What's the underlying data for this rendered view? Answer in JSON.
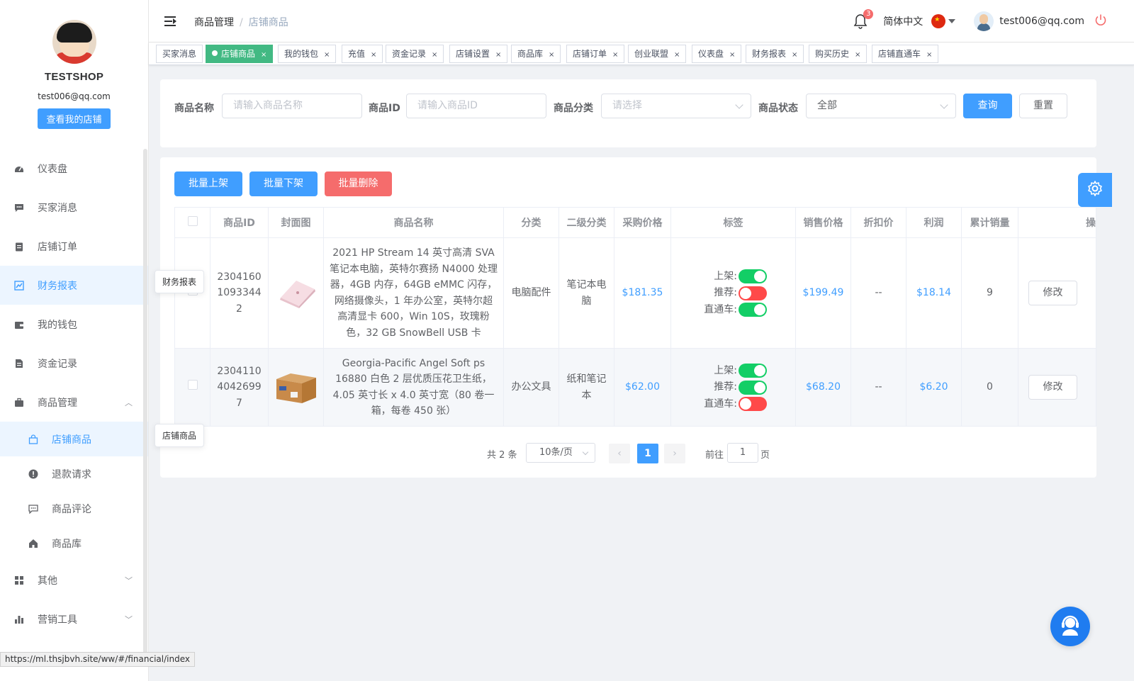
{
  "sidebar": {
    "shop_name": "TESTSHOP",
    "email": "test006@qq.com",
    "view_shop_btn": "查看我的店铺",
    "menu": [
      {
        "label": "仪表盘",
        "icon": "dashboard-icon"
      },
      {
        "label": "买家消息",
        "icon": "chat-icon"
      },
      {
        "label": "店铺订单",
        "icon": "clipboard-icon"
      },
      {
        "label": "财务报表",
        "icon": "chart-line-icon"
      },
      {
        "label": "我的钱包",
        "icon": "wallet-icon"
      },
      {
        "label": "资金记录",
        "icon": "document-icon"
      },
      {
        "label": "商品管理",
        "icon": "briefcase-icon"
      },
      {
        "label": "其他",
        "icon": "grid-icon"
      },
      {
        "label": "营销工具",
        "icon": "bar-chart-icon"
      }
    ],
    "submenu": [
      {
        "label": "店铺商品",
        "icon": "shopping-bag-icon"
      },
      {
        "label": "退款请求",
        "icon": "alert-circle-icon"
      },
      {
        "label": "商品评论",
        "icon": "comment-icon"
      },
      {
        "label": "商品库",
        "icon": "home-icon"
      }
    ],
    "tooltip_financial": "财务报表",
    "tooltip_store": "店铺商品"
  },
  "header": {
    "breadcrumb": [
      "商品管理",
      "店铺商品"
    ],
    "breadcrumb_sep": "/",
    "notification_count": "3",
    "language": "简体中文",
    "user": "test006@qq.com"
  },
  "tags": [
    {
      "label": "买家消息",
      "closable": false,
      "active": false
    },
    {
      "label": "店铺商品",
      "closable": true,
      "active": true
    },
    {
      "label": "我的钱包",
      "closable": true,
      "active": false
    },
    {
      "label": "充值",
      "closable": true,
      "active": false
    },
    {
      "label": "资金记录",
      "closable": true,
      "active": false
    },
    {
      "label": "店铺设置",
      "closable": true,
      "active": false
    },
    {
      "label": "商品库",
      "closable": true,
      "active": false
    },
    {
      "label": "店铺订单",
      "closable": true,
      "active": false
    },
    {
      "label": "创业联盟",
      "closable": true,
      "active": false
    },
    {
      "label": "仪表盘",
      "closable": true,
      "active": false
    },
    {
      "label": "财务报表",
      "closable": true,
      "active": false
    },
    {
      "label": "购买历史",
      "closable": true,
      "active": false
    },
    {
      "label": "店铺直通车",
      "closable": true,
      "active": false
    }
  ],
  "filter": {
    "name_label": "商品名称",
    "name_placeholder": "请输入商品名称",
    "id_label": "商品ID",
    "id_placeholder": "请输入商品ID",
    "category_label": "商品分类",
    "category_placeholder": "请选择",
    "status_label": "商品状态",
    "status_value": "全部",
    "search_btn": "查询",
    "reset_btn": "重置"
  },
  "actions": {
    "batch_on": "批量上架",
    "batch_off": "批量下架",
    "batch_delete": "批量删除"
  },
  "table": {
    "headers": [
      "商品ID",
      "封面图",
      "商品名称",
      "分类",
      "二级分类",
      "采购价格",
      "标签",
      "销售价格",
      "折扣价",
      "利润",
      "累计销量",
      "操"
    ],
    "tag_labels": [
      "上架:",
      "推荐:",
      "直通车:"
    ],
    "edit_label": "修改",
    "rows": [
      {
        "id": "23041601093344 2",
        "id_lines": [
          "2304160",
          "1093344",
          "2"
        ],
        "image": "laptop-image",
        "name": "2021 HP Stream 14 英寸高清 SVA 笔记本电脑，英特尔赛扬 N4000 处理器，4GB 内存，64GB eMMC 闪存，网络摄像头，1 年办公室，英特尔超高清显卡 600，Win 10S，玫瑰粉色，32 GB SnowBell USB 卡",
        "category": "电脑配件",
        "subcategory": "笔记本电脑",
        "purchase_price": "$181.35",
        "tags": {
          "on_shelf": true,
          "recommended": false,
          "express": true
        },
        "sale_price": "$199.49",
        "discount": "--",
        "profit": "$18.14",
        "sales": "9"
      },
      {
        "id": "23041104042699 7",
        "id_lines": [
          "2304110",
          "4042699",
          "7"
        ],
        "image": "paper-box-image",
        "name": "Georgia-Pacific Angel Soft ps 16880 白色 2 层优质压花卫生纸，4.05 英寸长 x 4.0 英寸宽（80 卷一箱，每卷 450 张）",
        "category": "办公文具",
        "subcategory": "纸和笔记本",
        "purchase_price": "$62.00",
        "tags": {
          "on_shelf": true,
          "recommended": true,
          "express": false
        },
        "sale_price": "$68.20",
        "discount": "--",
        "profit": "$6.20",
        "sales": "0"
      }
    ]
  },
  "pagination": {
    "total": "共 2 条",
    "page_size": "10条/页",
    "prev": "‹",
    "current": "1",
    "next": "›",
    "goto": "前往",
    "goto_value": "1",
    "page_suffix": "页"
  },
  "status_url": "https://ml.thsjbvh.site/ww/#/financial/index"
}
